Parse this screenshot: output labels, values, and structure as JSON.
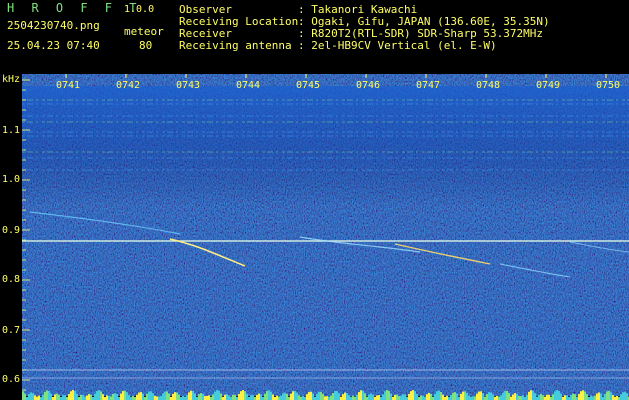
{
  "app": {
    "name": "H R O F F T",
    "version": "1.0.0"
  },
  "file": {
    "name": "2504230740.png",
    "datetime": "25.04.23 07:40"
  },
  "count": {
    "type": "meteor",
    "value": "80"
  },
  "info": [
    {
      "label": "Observer",
      "value": ": Takanori Kawachi"
    },
    {
      "label": "Receiving Location",
      "value": ": Ogaki, Gifu, JAPAN (136.60E, 35.35N)"
    },
    {
      "label": "Receiver",
      "value": ": R820T2(RTL-SDR) SDR-Sharp 53.372MHz"
    },
    {
      "label": "Receiving antenna",
      "value": ": 2el-HB9CV Vertical (el. E-W)"
    }
  ],
  "axis": {
    "unit": "kHz",
    "freq_ticks": [
      "1.1",
      "1.0",
      "0.9",
      "0.8",
      "0.7",
      "0.6"
    ],
    "time_ticks": [
      "0741",
      "0742",
      "0743",
      "0744",
      "0745",
      "0746",
      "0747",
      "0748",
      "0749",
      "0750"
    ]
  },
  "colors": {
    "background": "#000000",
    "text": "#ffff66",
    "logo": "#7fe07f",
    "carrier": "#ffffff"
  }
}
